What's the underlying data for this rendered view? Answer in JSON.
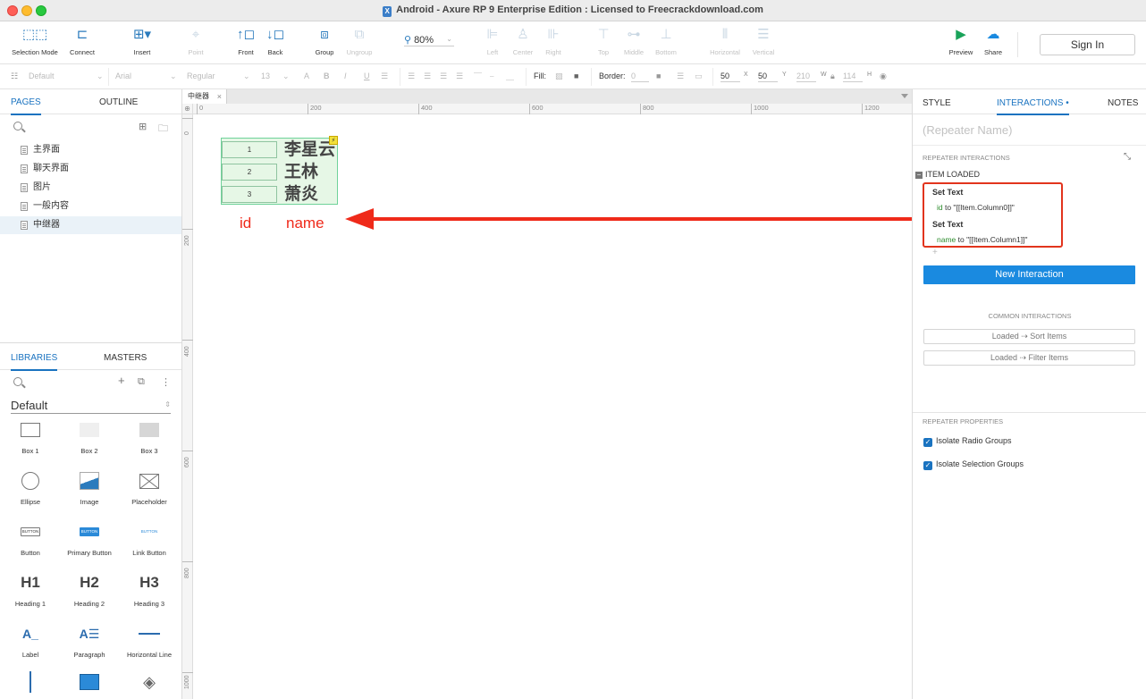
{
  "window": {
    "title": "Android - Axure RP 9 Enterprise Edition : Licensed to Freecrackdownload.com"
  },
  "toolbar": {
    "selection_mode": "Selection Mode",
    "connect": "Connect",
    "insert": "Insert",
    "point": "Point",
    "front": "Front",
    "back": "Back",
    "group": "Group",
    "ungroup": "Ungroup",
    "zoom": "80%",
    "left": "Left",
    "center": "Center",
    "right": "Right",
    "top": "Top",
    "middle": "Middle",
    "bottom": "Bottom",
    "horizontal": "Horizontal",
    "vertical": "Vertical",
    "preview": "Preview",
    "share": "Share",
    "sign_in": "Sign In"
  },
  "format_bar": {
    "style": "Default",
    "font": "Arial",
    "weight": "Regular",
    "size": "13",
    "fill_label": "Fill:",
    "border_label": "Border:",
    "border_value": "0",
    "x_value": "50",
    "x_label": "X",
    "y_value": "50",
    "y_label": "Y",
    "w_value": "210",
    "w_label": "W",
    "h_value": "114",
    "h_label": "H"
  },
  "left_panel": {
    "tabs": {
      "pages": "PAGES",
      "outline": "OUTLINE"
    },
    "pages": [
      "主界面",
      "聊天界面",
      "图片",
      "一般内容",
      "中继器"
    ],
    "selected_page": "中继器",
    "library_tabs": {
      "libraries": "LIBRARIES",
      "masters": "MASTERS"
    },
    "library_name": "Default",
    "widgets": [
      "Box 1",
      "Box 2",
      "Box 3",
      "Ellipse",
      "Image",
      "Placeholder",
      "Button",
      "Primary Button",
      "Link Button",
      "Heading 1",
      "Heading 2",
      "Heading 3",
      "Label",
      "Paragraph",
      "Horizontal Line"
    ],
    "widget_glyphs": {
      "button": "BUTTON",
      "h1": "H1",
      "h2": "H2",
      "h3": "H3",
      "label": "A_"
    }
  },
  "canvas": {
    "doc_tab": "中继器",
    "ruler_h": [
      "0",
      "200",
      "400",
      "600",
      "800",
      "1000",
      "1200"
    ],
    "ruler_v": [
      "0",
      "200",
      "400",
      "600",
      "800",
      "1000"
    ],
    "repeater_rows": [
      {
        "id": "1",
        "name": "李星云"
      },
      {
        "id": "2",
        "name": "王林"
      },
      {
        "id": "3",
        "name": "萧炎"
      }
    ],
    "annotation_id": "id",
    "annotation_name": "name"
  },
  "right_panel": {
    "tabs": {
      "style": "STYLE",
      "interactions": "INTERACTIONS •",
      "notes": "NOTES"
    },
    "repeater_name_placeholder": "(Repeater Name)",
    "repeater_interactions_header": "REPEATER INTERACTIONS",
    "event": "ITEM LOADED",
    "actions": [
      {
        "action": "Set Text",
        "target": "id",
        "value": " to \"[[Item.Column0]]\""
      },
      {
        "action": "Set Text",
        "target": "name",
        "value": " to \"[[Item.Column1]]\""
      }
    ],
    "new_interaction": "New Interaction",
    "common_interactions_header": "COMMON INTERACTIONS",
    "common_interactions": [
      "Loaded ⇢ Sort Items",
      "Loaded ⇢ Filter Items"
    ],
    "repeater_properties_header": "REPEATER PROPERTIES",
    "properties": [
      "Isolate Radio Groups",
      "Isolate Selection Groups"
    ]
  },
  "colors": {
    "accent": "#1a73c0",
    "primary_button": "#1a8ae0",
    "annotation_red": "#ef2a1a",
    "repeater_fill": "#e6f7e6"
  }
}
